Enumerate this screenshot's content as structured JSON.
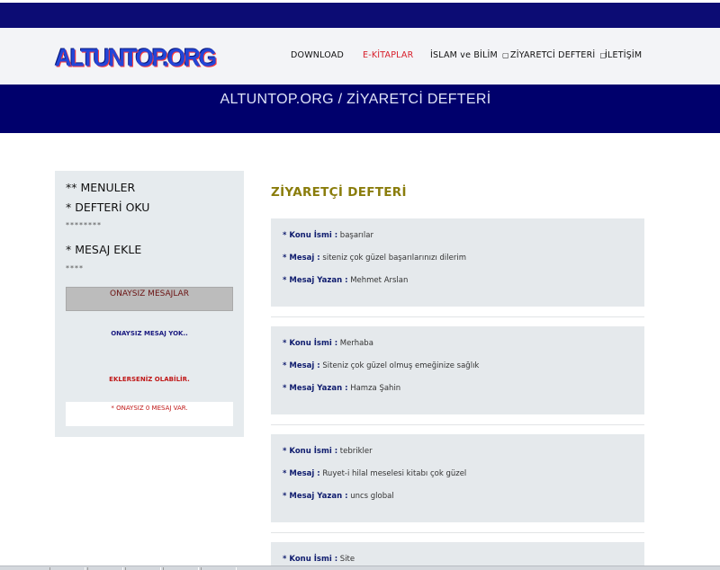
{
  "header": {
    "logo_text": "ALTUNTOP.ORG",
    "nav": [
      {
        "label": "DOWNLOAD",
        "active": false
      },
      {
        "label": "E-KİTAPLAR",
        "active": true
      },
      {
        "label": "İSLAM ve BİLİM",
        "dropdown": true
      },
      {
        "label": "ZİYARETCİ DEFTERİ",
        "dropdown": true
      },
      {
        "label": "İLETİŞİM"
      }
    ],
    "caret": "▢"
  },
  "banner": {
    "title": "ALTUNTOP.ORG / ZİYARETCİ DEFTERİ"
  },
  "sidebar": {
    "menu_heading": "** MENULER",
    "read_link": "* DEFTERİ OKU",
    "stars_1": "********",
    "add_link": "* MESAJ EKLE",
    "stars_2": "****",
    "pending_button": "ONAYSIZ MESAJLAR",
    "no_pending": "ONAYSIZ MESAJ YOK..",
    "hint": "EKLERSENİZ OLABİLİR.",
    "count_text": "* ONAYSIZ 0 MESAJ VAR."
  },
  "main": {
    "title": "ZİYARETÇİ DEFTERİ",
    "labels": {
      "subject": "* Konu İsmi :",
      "message": "* Mesaj :",
      "author": "* Mesaj Yazan :"
    },
    "entries": [
      {
        "subject": "başarılar",
        "message": "siteniz çok güzel başarılarınızı dilerim",
        "author": "Mehmet Arslan"
      },
      {
        "subject": "Merhaba",
        "message": "Siteniz çok güzel olmuş emeğinize sağlık",
        "author": "Hamza Şahin"
      },
      {
        "subject": "tebrikler",
        "message": "Ruyet-i hilal meselesi kitabı çok güzel",
        "author": "uncs global"
      },
      {
        "subject": "Site"
      }
    ]
  },
  "colors": {
    "navy": "#00006c",
    "accent_red": "#d81e2a",
    "title_olive": "#8a7d0c"
  }
}
